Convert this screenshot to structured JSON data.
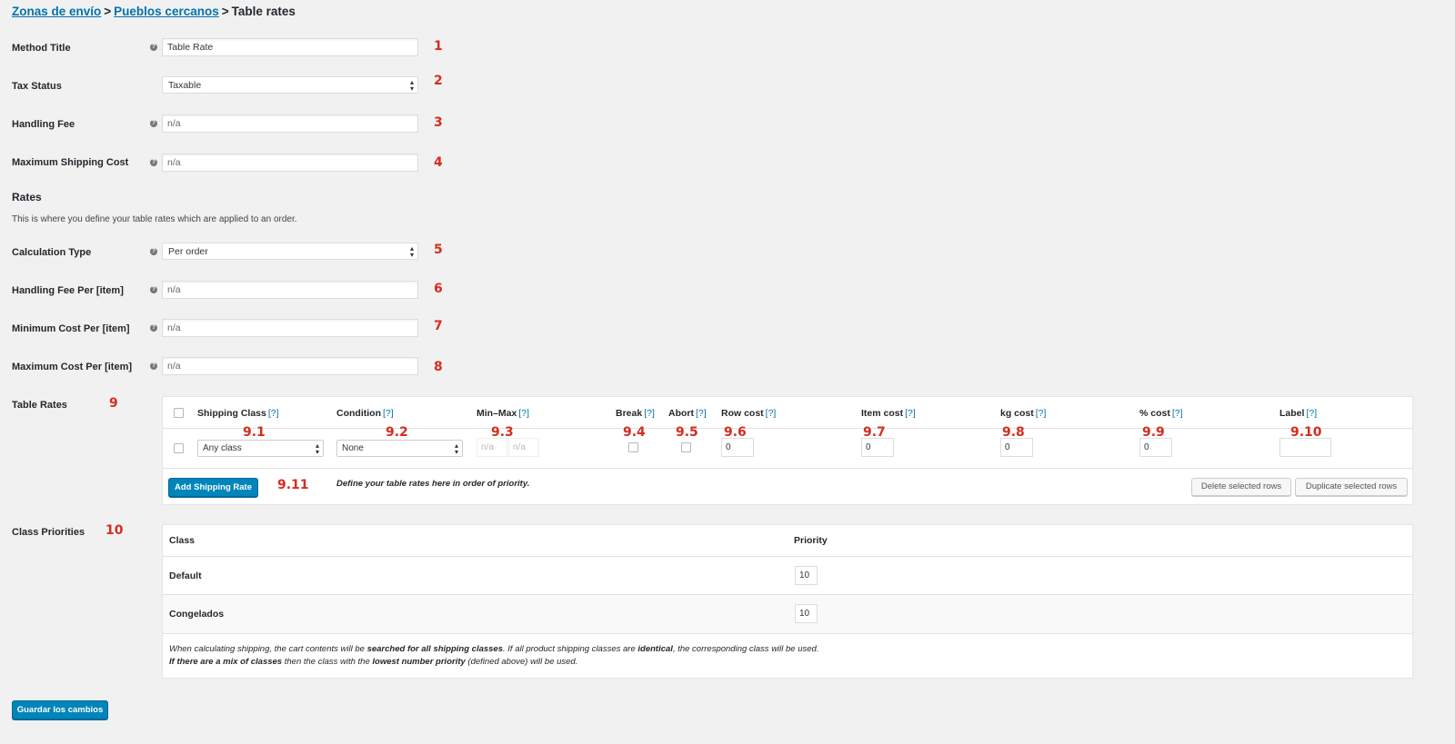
{
  "breadcrumb": {
    "crumb1": "Zonas de envío",
    "crumb2": "Pueblos cercanos",
    "sep": ">",
    "current": "Table rates"
  },
  "fields": {
    "method_title": {
      "label": "Method Title",
      "value": "Table Rate",
      "marker": "1"
    },
    "tax_status": {
      "label": "Tax Status",
      "value": "Taxable",
      "marker": "2"
    },
    "handling_fee": {
      "label": "Handling Fee",
      "placeholder": "n/a",
      "marker": "3"
    },
    "max_shipping_cost": {
      "label": "Maximum Shipping Cost",
      "placeholder": "n/a",
      "marker": "4"
    },
    "calculation_type": {
      "label": "Calculation Type",
      "value": "Per order",
      "marker": "5"
    },
    "handling_fee_per": {
      "label": "Handling Fee Per [item]",
      "placeholder": "n/a",
      "marker": "6"
    },
    "min_cost_per": {
      "label": "Minimum Cost Per [item]",
      "placeholder": "n/a",
      "marker": "7"
    },
    "max_cost_per": {
      "label": "Maximum Cost Per [item]",
      "placeholder": "n/a",
      "marker": "8"
    }
  },
  "rates_section": {
    "title": "Rates",
    "description": "This is where you define your table rates which are applied to an order."
  },
  "table_rates": {
    "label": "Table Rates",
    "marker": "9",
    "help_link": "[?]",
    "columns": {
      "shipping_class": "Shipping Class",
      "condition": "Condition",
      "min_max": "Min–Max",
      "break": "Break",
      "abort": "Abort",
      "row_cost": "Row cost",
      "item_cost": "Item cost",
      "kg_cost": "kg cost",
      "pct_cost": "% cost",
      "label": "Label"
    },
    "col_markers": {
      "shipping_class": "9.1",
      "condition": "9.2",
      "min_max": "9.3",
      "break": "9.4",
      "abort": "9.5",
      "row_cost": "9.6",
      "item_cost": "9.7",
      "kg_cost": "9.8",
      "pct_cost": "9.9",
      "label": "9.10"
    },
    "row": {
      "shipping_class": "Any class",
      "condition": "None",
      "min_placeholder": "n/a",
      "max_placeholder": "n/a",
      "row_cost": "0",
      "item_cost": "0",
      "kg_cost": "0",
      "pct_cost": "0",
      "label": ""
    },
    "add_button": "Add Shipping Rate",
    "add_marker": "9.11",
    "footer_note": "Define your table rates here in order of priority.",
    "delete_button": "Delete selected rows",
    "duplicate_button": "Duplicate selected rows"
  },
  "class_priorities": {
    "label": "Class Priorities",
    "marker": "10",
    "header_class": "Class",
    "header_priority": "Priority",
    "rows": [
      {
        "name": "Default",
        "priority": "10"
      },
      {
        "name": "Congelados",
        "priority": "10"
      }
    ],
    "note": {
      "l1_a": "When calculating shipping, the cart contents will be ",
      "l1_b": "searched for all shipping classes",
      "l1_c": ". If all product shipping classes are ",
      "l1_d": "identical",
      "l1_e": ", the corresponding class will be used.",
      "l2_a": "If there are a mix of classes",
      "l2_b": " then the class with the ",
      "l2_c": "lowest number priority",
      "l2_d": " (defined above) will be used."
    }
  },
  "save_button": "Guardar los cambios",
  "colors": {
    "link": "#0073aa",
    "primary": "#0085ba",
    "marker": "#d52d1f",
    "background": "#f1f1f1"
  }
}
